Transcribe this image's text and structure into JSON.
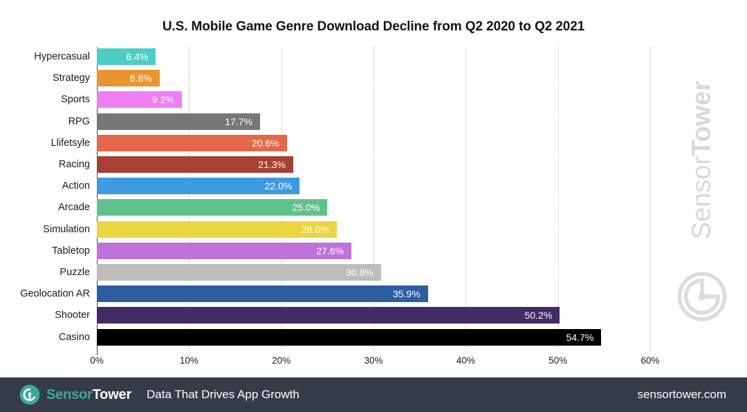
{
  "chart_data": {
    "type": "bar",
    "orientation": "horizontal",
    "title": "U.S. Mobile Game Genre Download Decline from Q2 2020 to Q2 2021",
    "xlabel": "",
    "ylabel": "",
    "xlim": [
      0,
      60
    ],
    "xticks": [
      "0%",
      "10%",
      "20%",
      "30%",
      "40%",
      "50%",
      "60%"
    ],
    "xtick_values": [
      0,
      10,
      20,
      30,
      40,
      50,
      60
    ],
    "grid": "vertical-dotted",
    "legend": "none",
    "categories": [
      "Hypercasual",
      "Strategy",
      "Sports",
      "RPG",
      "Llifetsyle",
      "Racing",
      "Action",
      "Arcade",
      "Simulation",
      "Tabletop",
      "Puzzle",
      "Geolocation AR",
      "Shooter",
      "Casino"
    ],
    "values": [
      6.4,
      6.8,
      9.2,
      17.7,
      20.6,
      21.3,
      22.0,
      25.0,
      26.0,
      27.6,
      30.8,
      35.9,
      50.2,
      54.7
    ],
    "value_labels": [
      "6.4%",
      "6.8%",
      "9.2%",
      "17.7%",
      "20.6%",
      "21.3%",
      "22.0%",
      "25.0%",
      "26.0%",
      "27.6%",
      "30.8%",
      "35.9%",
      "50.2%",
      "54.7%"
    ],
    "colors": [
      "#4ecdc4",
      "#eb9430",
      "#ef7ef5",
      "#777777",
      "#e4694a",
      "#a64032",
      "#3d9ae0",
      "#5fc28c",
      "#ead63f",
      "#bf72d8",
      "#bdbdbd",
      "#2c5ea0",
      "#432b66",
      "#000000"
    ]
  },
  "watermark": {
    "brand_light": "Sensor",
    "brand_bold": "Tower",
    "logo_icon": "sensortower-circle-logo"
  },
  "footer": {
    "logo_icon": "sensortower-logo-icon",
    "brand_first": "Sensor",
    "brand_second": "Tower",
    "tagline": "Data That Drives App Growth",
    "url": "sensortower.com",
    "background_color": "#353b48",
    "accent_color": "#3aab94"
  }
}
